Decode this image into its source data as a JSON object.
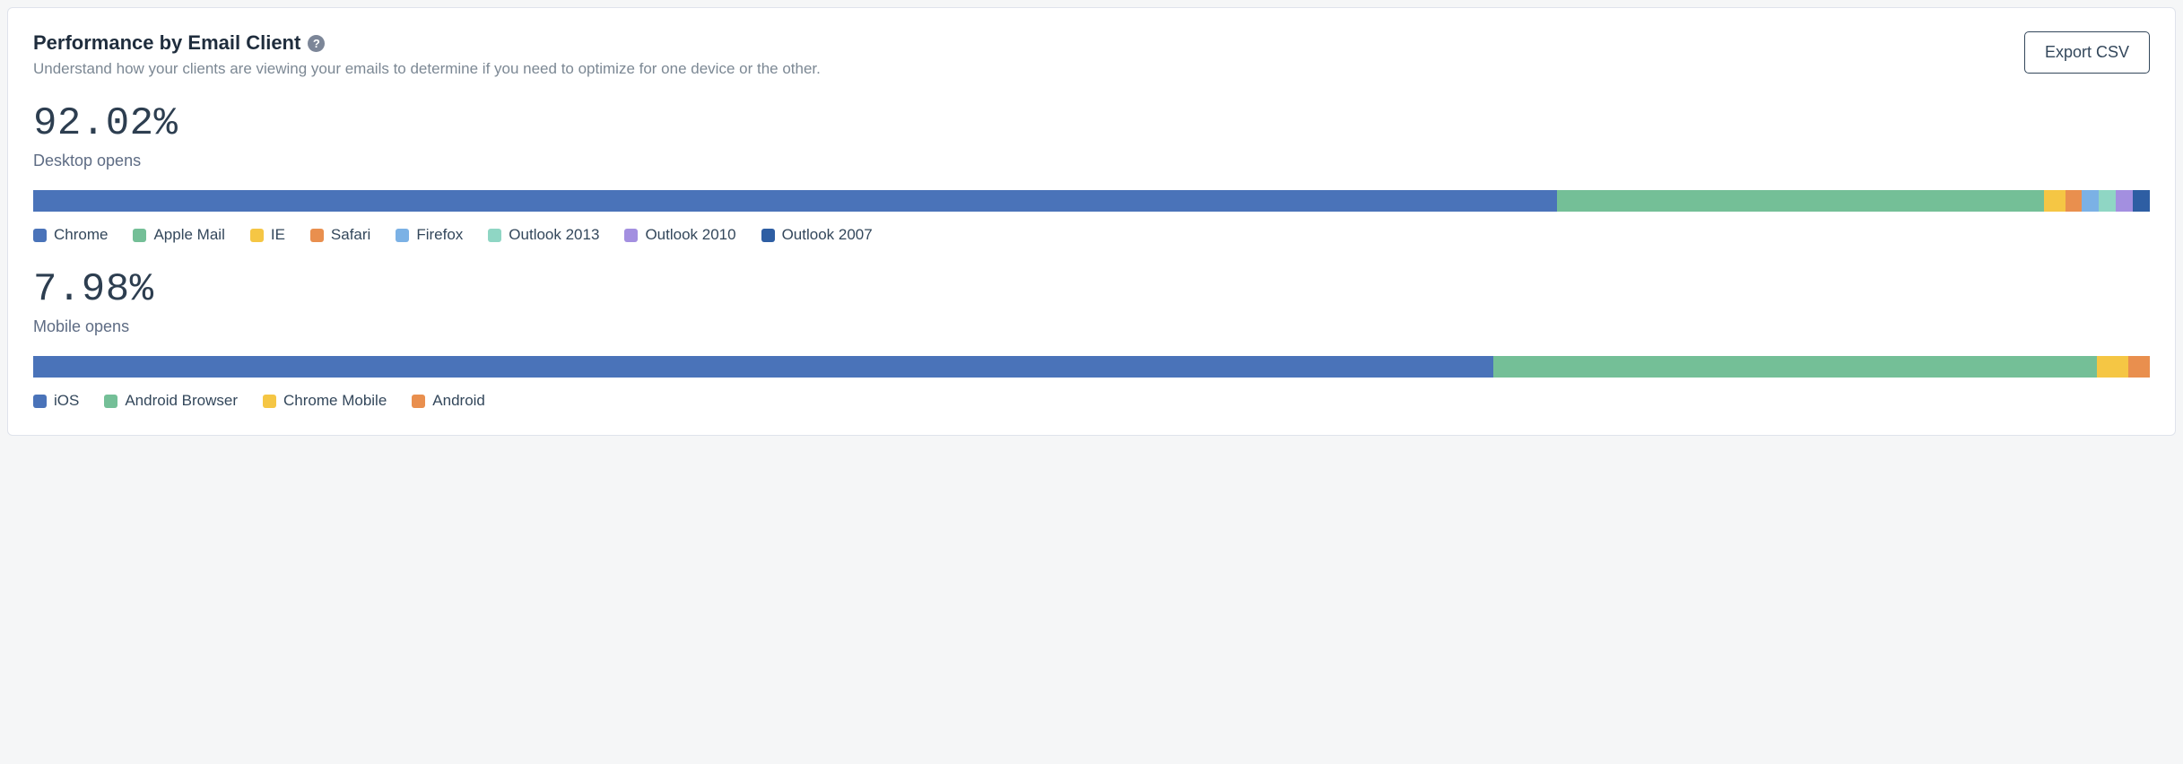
{
  "header": {
    "title": "Performance by Email Client",
    "subtitle": "Understand how your clients are viewing your emails to determine if you need to optimize for one device or the other.",
    "help_icon_char": "?",
    "export_label": "Export CSV"
  },
  "colors": {
    "blue": "#4a73b9",
    "green": "#74bf97",
    "yellow": "#f5c644",
    "orange": "#e98f4e",
    "lblue": "#7bb1e5",
    "teal": "#8fd6c4",
    "purple": "#a38fe0",
    "navy": "#2e5ea3"
  },
  "desktop": {
    "value": "92.02%",
    "label": "Desktop opens",
    "segments": [
      {
        "name": "Chrome",
        "value": 72.0,
        "color": "blue"
      },
      {
        "name": "Apple Mail",
        "value": 23.0,
        "color": "green"
      },
      {
        "name": "IE",
        "value": 1.0,
        "color": "yellow"
      },
      {
        "name": "Safari",
        "value": 0.8,
        "color": "orange"
      },
      {
        "name": "Firefox",
        "value": 0.8,
        "color": "lblue"
      },
      {
        "name": "Outlook 2013",
        "value": 0.8,
        "color": "teal"
      },
      {
        "name": "Outlook 2010",
        "value": 0.8,
        "color": "purple"
      },
      {
        "name": "Outlook 2007",
        "value": 0.8,
        "color": "navy"
      }
    ]
  },
  "mobile": {
    "value": "7.98%",
    "label": "Mobile opens",
    "segments": [
      {
        "name": "iOS",
        "value": 69.0,
        "color": "blue"
      },
      {
        "name": "Android Browser",
        "value": 28.5,
        "color": "green"
      },
      {
        "name": "Chrome Mobile",
        "value": 1.5,
        "color": "yellow"
      },
      {
        "name": "Android",
        "value": 1.0,
        "color": "orange"
      }
    ]
  },
  "chart_data": [
    {
      "type": "bar",
      "title": "Desktop opens — 92.02%",
      "orientation": "stacked-horizontal",
      "categories": [
        "Chrome",
        "Apple Mail",
        "IE",
        "Safari",
        "Firefox",
        "Outlook 2013",
        "Outlook 2010",
        "Outlook 2007"
      ],
      "values": [
        72.0,
        23.0,
        1.0,
        0.8,
        0.8,
        0.8,
        0.8,
        0.8
      ],
      "unit": "percent",
      "colors_palette": [
        "blue",
        "green",
        "yellow",
        "orange",
        "lblue",
        "teal",
        "purple",
        "navy"
      ]
    },
    {
      "type": "bar",
      "title": "Mobile opens — 7.98%",
      "orientation": "stacked-horizontal",
      "categories": [
        "iOS",
        "Android Browser",
        "Chrome Mobile",
        "Android"
      ],
      "values": [
        69.0,
        28.5,
        1.5,
        1.0
      ],
      "unit": "percent",
      "colors_palette": [
        "blue",
        "green",
        "yellow",
        "orange"
      ]
    }
  ]
}
